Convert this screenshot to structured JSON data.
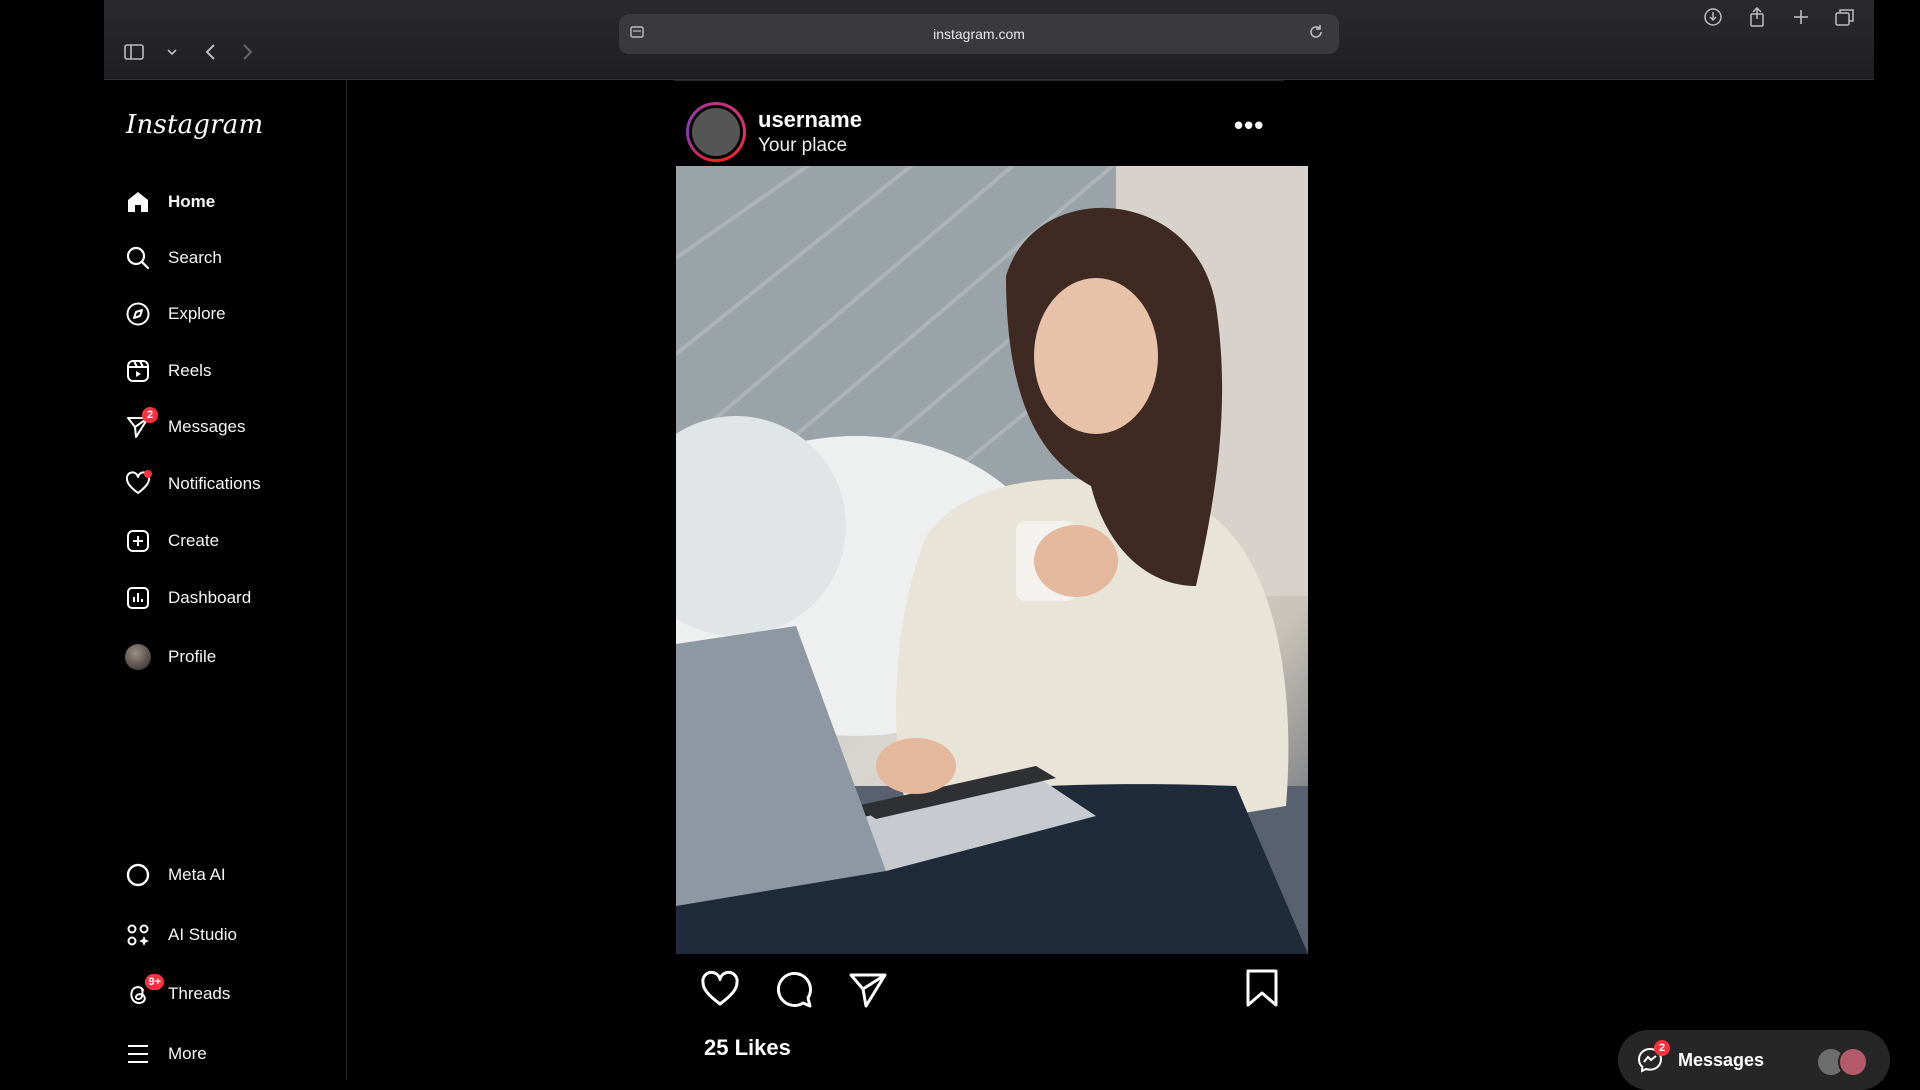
{
  "browser": {
    "url": "instagram.com"
  },
  "sidebar": {
    "logo": "Instagram",
    "items": [
      {
        "label": "Home",
        "icon": "home-icon",
        "active": true
      },
      {
        "label": "Search",
        "icon": "search-icon"
      },
      {
        "label": "Explore",
        "icon": "compass-icon"
      },
      {
        "label": "Reels",
        "icon": "reels-icon"
      },
      {
        "label": "Messages",
        "icon": "messenger-icon",
        "badge": "2"
      },
      {
        "label": "Notifications",
        "icon": "heart-icon",
        "dot": true
      },
      {
        "label": "Create",
        "icon": "plus-square-icon"
      },
      {
        "label": "Dashboard",
        "icon": "bar-chart-icon"
      },
      {
        "label": "Profile",
        "icon": "avatar"
      }
    ],
    "bottom_items": [
      {
        "label": "Meta AI",
        "icon": "meta-ai-icon"
      },
      {
        "label": "AI Studio",
        "icon": "ai-studio-icon"
      },
      {
        "label": "Threads",
        "icon": "threads-icon",
        "badge": "9+"
      },
      {
        "label": "More",
        "icon": "hamburger-icon"
      }
    ]
  },
  "post": {
    "username": "username",
    "location": "Your place",
    "likes": "25 Likes"
  },
  "messages_pill": {
    "label": "Messages",
    "badge": "2"
  },
  "colors": {
    "background": "#000000",
    "badge": "#ff3040",
    "pill": "#262626"
  }
}
